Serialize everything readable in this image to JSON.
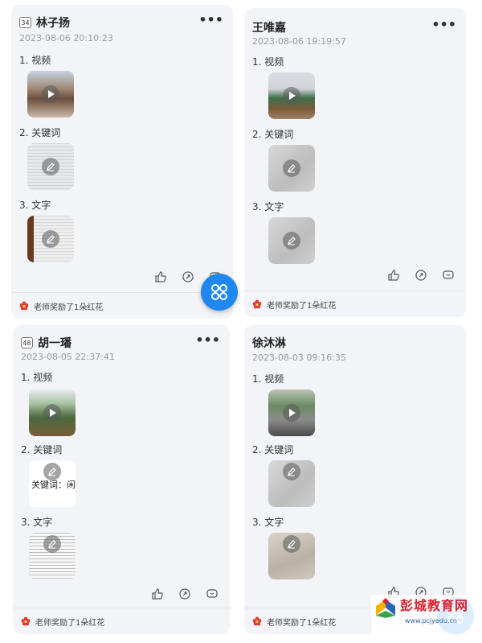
{
  "cards": [
    {
      "badge": "34",
      "name": "林子扬",
      "time": "2023-08-06 20:10:23",
      "sections": [
        "1. 视频",
        "2. 关键词",
        "3. 文字"
      ],
      "award": "老师奖励了1朵红花"
    },
    {
      "badge": "",
      "name": "王唯嘉",
      "time": "2023-08-06 19:19:57",
      "sections": [
        "1. 视频",
        "2. 关键词",
        "3. 文字"
      ],
      "award": "老师奖励了1朵红花"
    },
    {
      "badge": "48",
      "name": "胡一璠",
      "time": "2023-08-05 22:37:41",
      "sections": [
        "1. 视频",
        "2. 关键词",
        "3. 文字"
      ],
      "keyword_image_text": "关键词：闲适",
      "award": "老师奖励了1朵红花"
    },
    {
      "badge": "",
      "name": "徐沐淋",
      "time": "2023-08-03 09:16:35",
      "sections": [
        "1. 视频",
        "2. 关键词",
        "3. 文字"
      ],
      "award": "老师奖励了1朵红花"
    }
  ],
  "more_label": "•••",
  "icons": {
    "like": "thumbs-up-icon",
    "share": "share-icon",
    "comment": "comment-icon",
    "edit": "pencil-icon",
    "play": "play-icon",
    "flower": "red-flower-icon",
    "fab": "grid-menu-icon"
  },
  "colors": {
    "card_bg": "#f3f4f8",
    "fab": "#1e88f0",
    "flower": "#e23b3b",
    "watermark_red": "#d7202e",
    "watermark_blue": "#2a66b5"
  },
  "watermark": {
    "title": "彭城教育网",
    "url": "www.pcjyedu.cn"
  }
}
